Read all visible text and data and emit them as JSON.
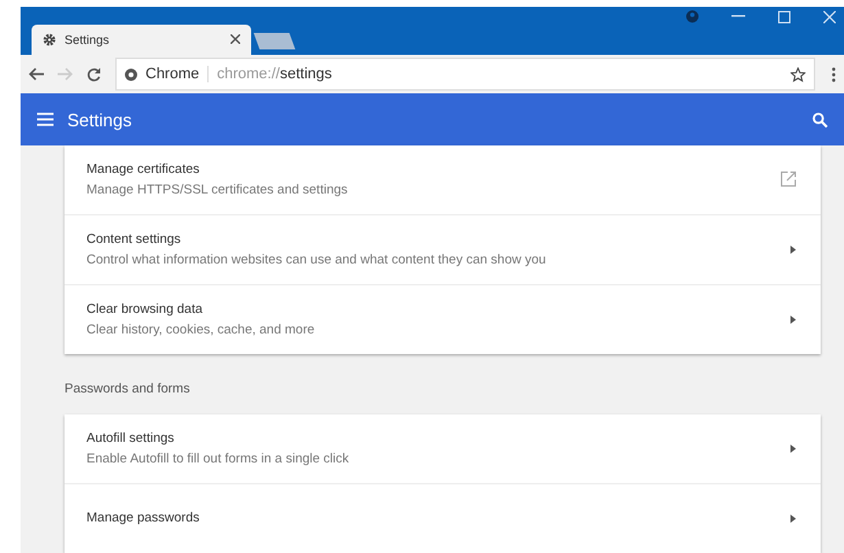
{
  "tab": {
    "title": "Settings"
  },
  "toolbar": {
    "site_label": "Chrome",
    "url_scheme": "chrome://",
    "url_path": "settings"
  },
  "header": {
    "title": "Settings"
  },
  "sections": [
    {
      "items": [
        {
          "kind": "external",
          "title": "Manage certificates",
          "description": "Manage HTTPS/SSL certificates and settings"
        },
        {
          "kind": "arrow",
          "title": "Content settings",
          "description": "Control what information websites can use and what content they can show you"
        },
        {
          "kind": "arrow",
          "title": "Clear browsing data",
          "description": "Clear history, cookies, cache, and more"
        }
      ]
    },
    {
      "heading": "Passwords and forms",
      "items": [
        {
          "kind": "arrow",
          "title": "Autofill settings",
          "description": "Enable Autofill to fill out forms in a single click"
        },
        {
          "kind": "arrow",
          "title": "Manage passwords"
        }
      ]
    }
  ]
}
